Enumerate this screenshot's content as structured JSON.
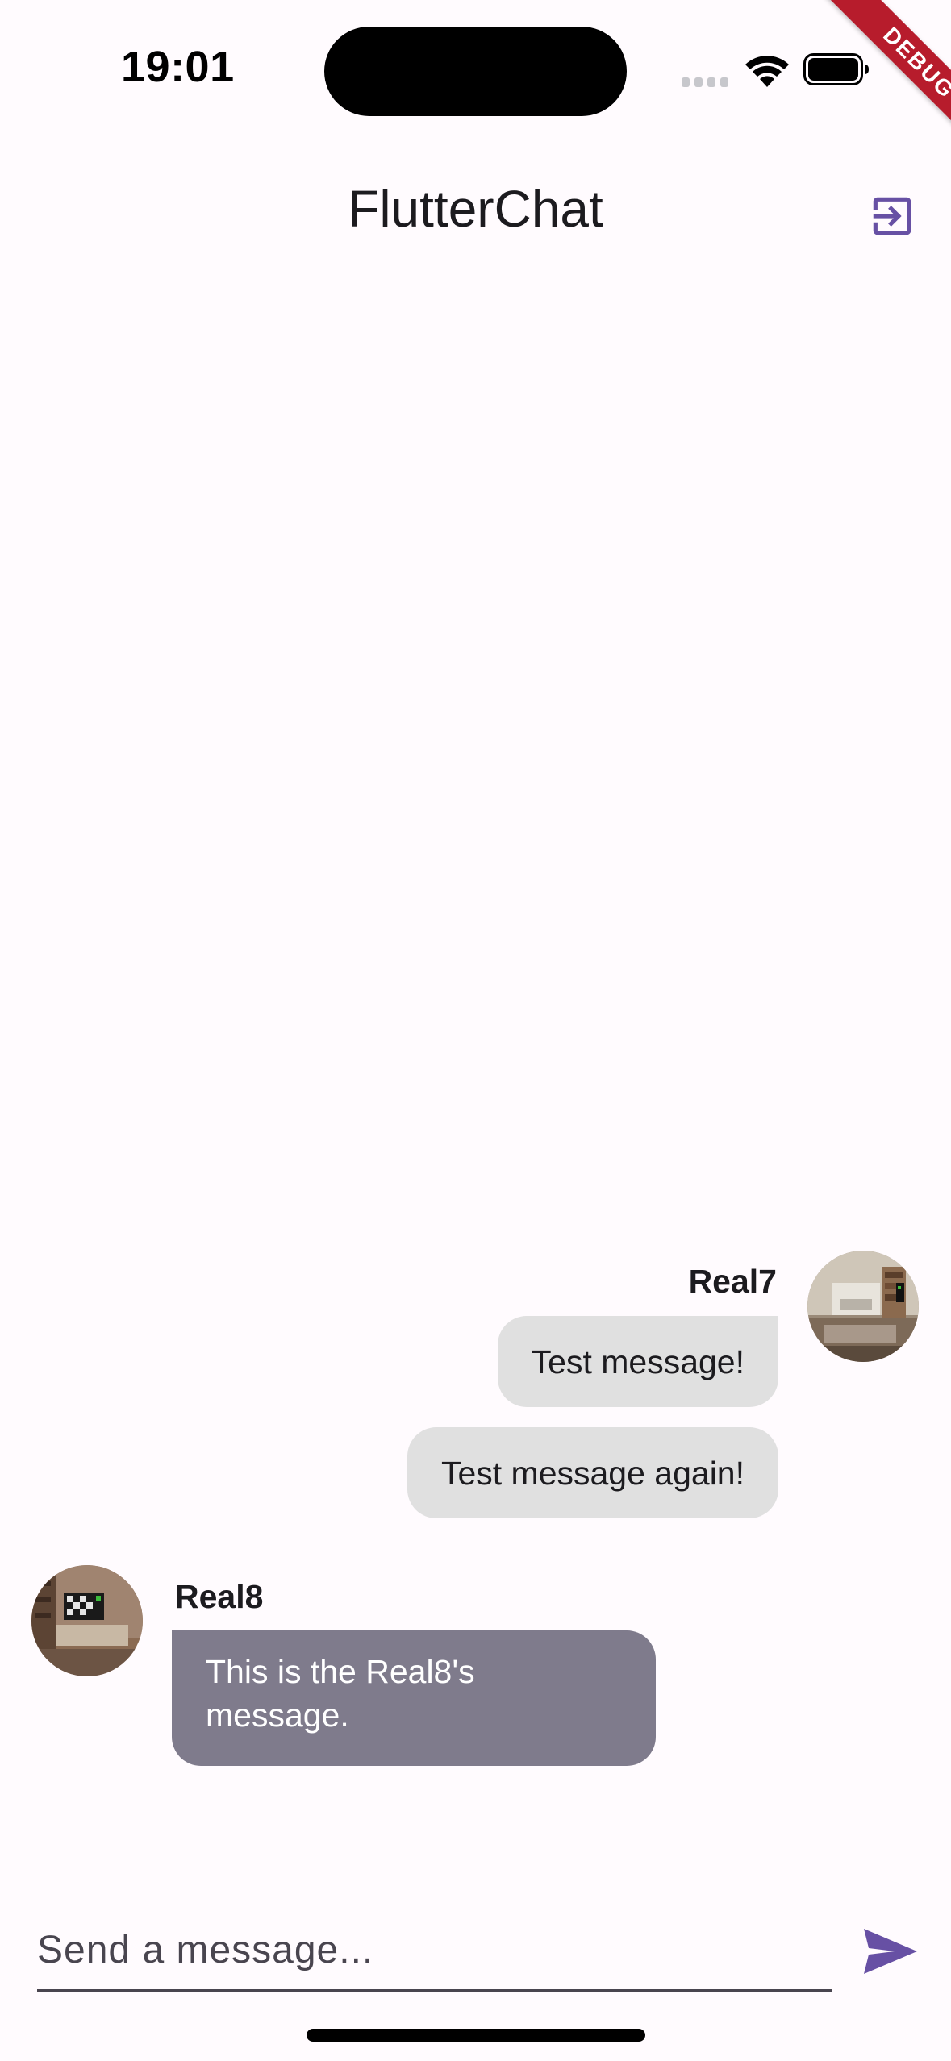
{
  "status_bar": {
    "time": "19:01"
  },
  "debug_banner": "DEBUG",
  "app_bar": {
    "title": "FlutterChat",
    "action_icon": "logout-icon"
  },
  "messages": [
    {
      "username": "Real7",
      "side": "right",
      "bubbles": [
        "Test message!",
        "Test message again!"
      ]
    },
    {
      "username": "Real8",
      "side": "left",
      "bubbles": [
        "This is the Real8's message."
      ]
    }
  ],
  "composer": {
    "placeholder": "Send a message...",
    "value": "",
    "send_icon": "send-icon"
  },
  "colors": {
    "background": "#fffbfe",
    "accent": "#6750a4",
    "bubble_grey": "#e0e0e0",
    "bubble_purple": "#7f7b8c",
    "debug_ribbon": "#b71c2c"
  }
}
